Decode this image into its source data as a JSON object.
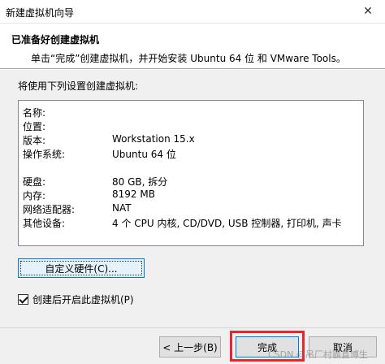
{
  "window": {
    "title": "新建虚拟机向导"
  },
  "header": {
    "title": "已准备好创建虚拟机",
    "subtitle": "单击“完成”创建虚拟机，并开始安装 Ubuntu 64 位 和 VMware Tools。"
  },
  "prompt": "将使用下列设置创建虚拟机:",
  "summary": [
    {
      "label": "名称:",
      "value": ""
    },
    {
      "label": "位置:",
      "value": ""
    },
    {
      "label": "版本:",
      "value": "Workstation 15.x"
    },
    {
      "label": "操作系统:",
      "value": "Ubuntu 64 位"
    },
    {
      "label": "",
      "value": ""
    },
    {
      "label": "硬盘:",
      "value": "80 GB, 拆分"
    },
    {
      "label": "内存:",
      "value": "8192 MB"
    },
    {
      "label": "网络适配器:",
      "value": "NAT"
    },
    {
      "label": "其他设备:",
      "value": "4 个 CPU 内核, CD/DVD, USB 控制器, 打印机, 声卡"
    }
  ],
  "custom_button": "自定义硬件(C)...",
  "power_on_checkbox": {
    "label": "创建后开启此虚拟机(P)",
    "checked": true
  },
  "buttons": {
    "back": "< 上一步(B)",
    "finish": "完成",
    "cancel": "取消"
  },
  "watermark": "CSDN @吊厂村霸直博生",
  "colors": {
    "highlight": "#e8262b",
    "focus": "#0078d7"
  }
}
